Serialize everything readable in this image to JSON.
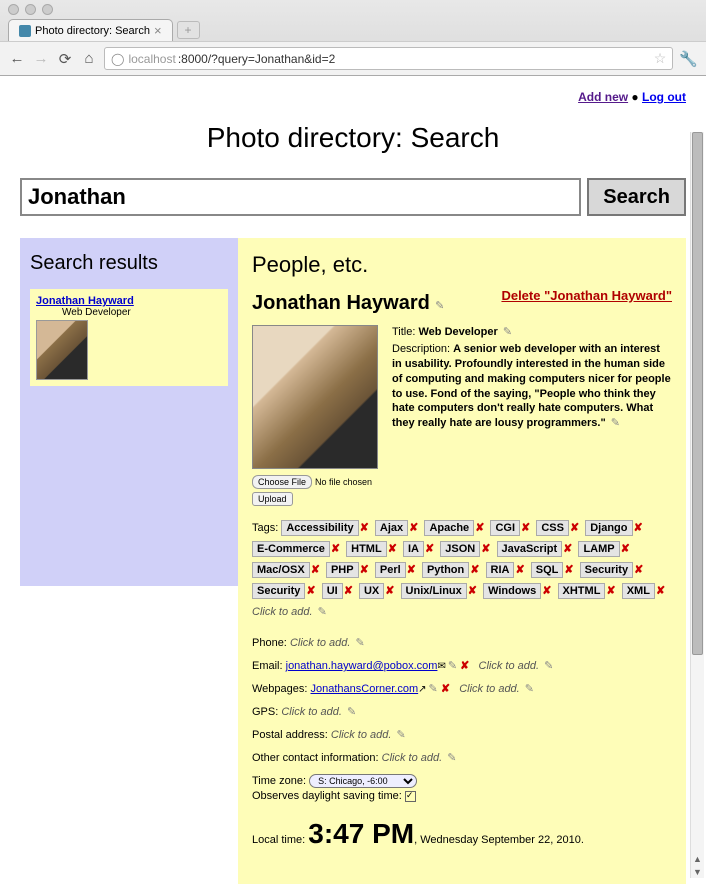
{
  "browser": {
    "tab_title": "Photo directory: Search",
    "url_prefix": "localhost",
    "url_rest": ":8000/?query=Jonathan&id=2"
  },
  "top_links": {
    "add_new": "Add new",
    "logout": "Log out"
  },
  "page_title": "Photo directory: Search",
  "search": {
    "value": "Jonathan",
    "button": "Search"
  },
  "sidebar": {
    "heading": "Search results",
    "result": {
      "name": "Jonathan Hayward",
      "sub": "Web Developer"
    }
  },
  "main": {
    "heading": "People, etc.",
    "delete_label": "Delete \"Jonathan Hayward\"",
    "person_name": "Jonathan Hayward",
    "choose_file": "Choose File",
    "no_file": "No file chosen",
    "upload": "Upload",
    "title_label": "Title:",
    "title_value": "Web Developer",
    "desc_label": "Description:",
    "desc_value": "A senior web developer with an interest in usability. Profoundly interested in the human side of computing and making computers nicer for people to use. Fond of the saying, \"People who think they hate computers don't really hate computers. What they really hate are lousy programmers.\"",
    "tags_label": "Tags:",
    "tags": [
      "Accessibility",
      "Ajax",
      "Apache",
      "CGI",
      "CSS",
      "Django",
      "E-Commerce",
      "HTML",
      "IA",
      "JSON",
      "JavaScript",
      "LAMP",
      "Mac/OSX",
      "PHP",
      "Perl",
      "Python",
      "RIA",
      "SQL",
      "Security",
      "Security",
      "UI",
      "UX",
      "Unix/Linux",
      "Windows",
      "XHTML",
      "XML"
    ],
    "click_to_add": "Click to add.",
    "phone_label": "Phone:",
    "email_label": "Email:",
    "email_value": "jonathan.hayward@pobox.com",
    "webpages_label": "Webpages:",
    "webpage_value": "JonathansCorner.com",
    "gps_label": "GPS:",
    "postal_label": "Postal address:",
    "other_label": "Other contact information:",
    "tz_label": "Time zone:",
    "tz_value": "S: Chicago, -6:00",
    "dst_label": "Observes daylight saving time:",
    "local_label": "Local time:",
    "local_time": "3:47 PM",
    "local_date": ", Wednesday September 22, 2010."
  }
}
